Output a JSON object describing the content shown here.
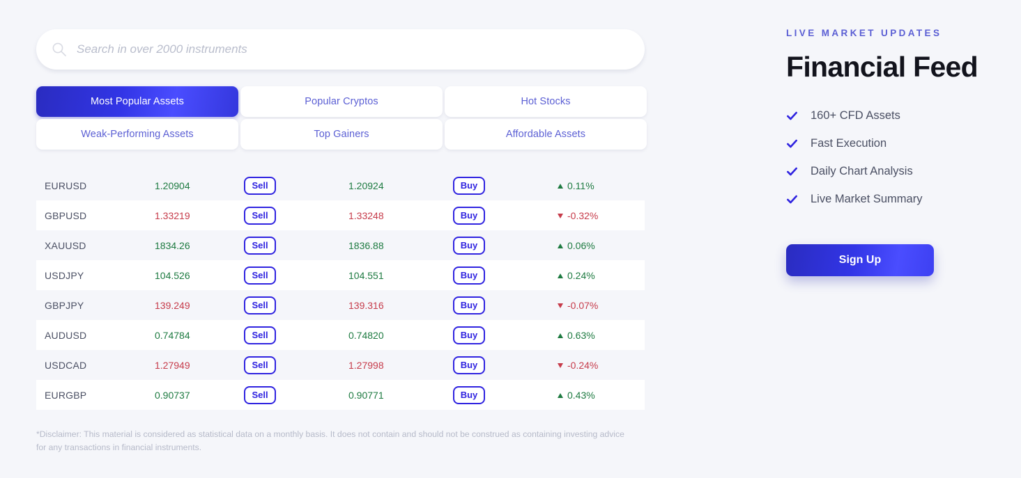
{
  "search": {
    "placeholder": "Search in over 2000 instruments",
    "value": "",
    "icon": "search-icon"
  },
  "tabs": [
    {
      "label": "Most Popular Assets",
      "active": true
    },
    {
      "label": "Popular Cryptos",
      "active": false
    },
    {
      "label": "Hot Stocks",
      "active": false
    },
    {
      "label": "Weak-Performing Assets",
      "active": false
    },
    {
      "label": "Top Gainers",
      "active": false
    },
    {
      "label": "Affordable Assets",
      "active": false
    }
  ],
  "table": {
    "sell_label": "Sell",
    "buy_label": "Buy",
    "rows": [
      {
        "symbol": "EURUSD",
        "sell": "1.20904",
        "buy": "1.20924",
        "change": "0.11%",
        "direction": "up"
      },
      {
        "symbol": "GBPUSD",
        "sell": "1.33219",
        "buy": "1.33248",
        "change": "-0.32%",
        "direction": "down"
      },
      {
        "symbol": "XAUUSD",
        "sell": "1834.26",
        "buy": "1836.88",
        "change": "0.06%",
        "direction": "up"
      },
      {
        "symbol": "USDJPY",
        "sell": "104.526",
        "buy": "104.551",
        "change": "0.24%",
        "direction": "up"
      },
      {
        "symbol": "GBPJPY",
        "sell": "139.249",
        "buy": "139.316",
        "change": "-0.07%",
        "direction": "down"
      },
      {
        "symbol": "AUDUSD",
        "sell": "0.74784",
        "buy": "0.74820",
        "change": "0.63%",
        "direction": "up"
      },
      {
        "symbol": "USDCAD",
        "sell": "1.27949",
        "buy": "1.27998",
        "change": "-0.24%",
        "direction": "down"
      },
      {
        "symbol": "EURGBP",
        "sell": "0.90737",
        "buy": "0.90771",
        "change": "0.43%",
        "direction": "up"
      }
    ]
  },
  "disclaimer": "*Disclaimer: This material is considered as statistical data on a monthly basis. It does not contain and should not be construed as containing investing advice for any transactions in financial instruments.",
  "panel": {
    "eyebrow": "LIVE MARKET UPDATES",
    "title": "Financial Feed",
    "features": [
      "160+ CFD Assets",
      "Fast Execution",
      "Daily Chart Analysis",
      "Live Market Summary"
    ],
    "signup_label": "Sign Up"
  },
  "colors": {
    "accent_blue": "#2f23e0",
    "accent_light": "#5b5fd4",
    "up_green": "#1d7a40",
    "down_red": "#c63b4a",
    "page_bg": "#f5f6fa",
    "row_alt": "#ffffff",
    "title_dark": "#12131c"
  }
}
